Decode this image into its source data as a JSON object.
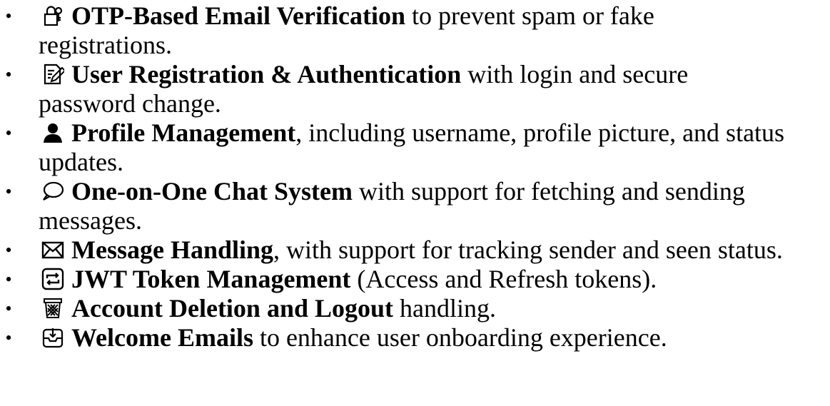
{
  "features": [
    {
      "icon": "key-lock-icon",
      "title": "OTP-Based Email Verification",
      "rest": " to prevent spam or fake",
      "cont": "registrations."
    },
    {
      "icon": "edit-document-icon",
      "title": "User Registration & Authentication",
      "rest": " with login and secure",
      "cont": "password change."
    },
    {
      "icon": "user-icon",
      "title": "Profile Management",
      "rest": ", including username, profile picture, and status",
      "cont": "updates."
    },
    {
      "icon": "speech-bubble-icon",
      "title": "One-on-One Chat System",
      "rest": " with support for fetching and sending",
      "cont": "messages."
    },
    {
      "icon": "envelope-icon",
      "title": "Message Handling",
      "rest": ", with support for tracking sender and seen status.",
      "cont": ""
    },
    {
      "icon": "repeat-icon",
      "title": "JWT Token Management",
      "rest": " (Access and Refresh tokens).",
      "cont": ""
    },
    {
      "icon": "wastebasket-icon",
      "title": "Account Deletion and Logout",
      "rest": " handling.",
      "cont": ""
    },
    {
      "icon": "inbox-tray-icon",
      "title": "Welcome Emails",
      "rest": " to enhance user onboarding experience.",
      "cont": ""
    }
  ]
}
